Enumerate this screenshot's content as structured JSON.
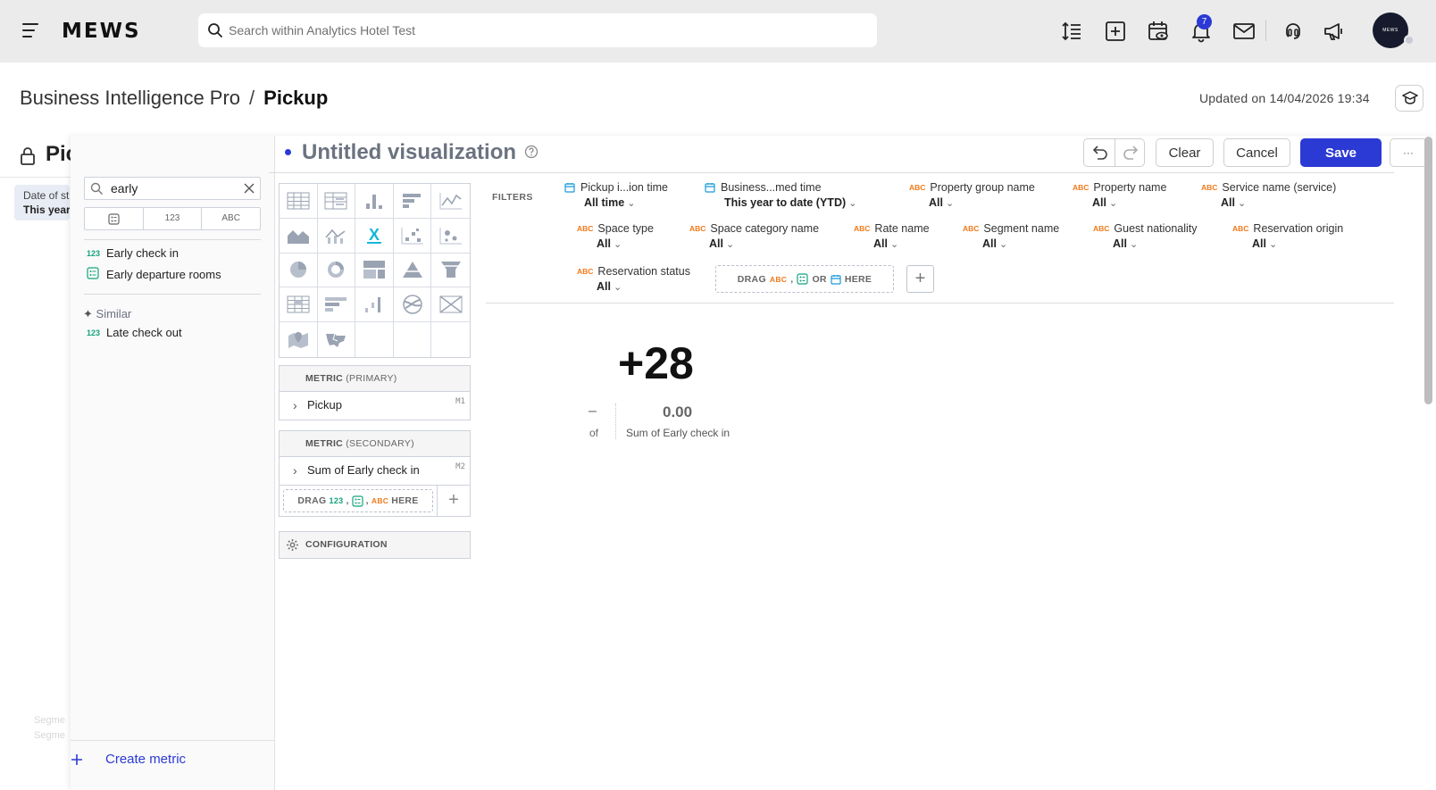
{
  "topbar": {
    "logo": "MEWS",
    "search_placeholder": "Search within Analytics Hotel Test",
    "notification_count": "7",
    "avatar_text": "MEWS"
  },
  "header": {
    "breadcrumb_parent": "Business Intelligence Pro",
    "breadcrumb_sep": "/",
    "breadcrumb_current": "Pickup",
    "updated": "Updated on 14/04/2026 19:34"
  },
  "background": {
    "title": "Pic",
    "filter_label": "Date of st",
    "filter_value": "This year",
    "seg1": "Segme",
    "seg2": "Segme"
  },
  "catalog": {
    "search_value": "early",
    "type_tabs": [
      "",
      "123",
      "ABC"
    ],
    "results": [
      {
        "tag": "123",
        "label": "Early check in"
      },
      {
        "tag": "",
        "label": "Early departure rooms"
      }
    ],
    "similar_label": "Similar",
    "similar": [
      {
        "tag": "123",
        "label": "Late check out"
      }
    ],
    "create_metric": "Create metric"
  },
  "viz": {
    "title": "Untitled visualization",
    "selected_type_glyph": "X"
  },
  "toolbar": {
    "clear": "Clear",
    "cancel": "Cancel",
    "save": "Save",
    "more": "···"
  },
  "buckets": {
    "primary_title": "METRIC",
    "primary_sub": "(PRIMARY)",
    "primary_item": "Pickup",
    "primary_tag": "M1",
    "secondary_title": "METRIC",
    "secondary_sub": "(SECONDARY)",
    "secondary_item": "Sum of Early check in",
    "secondary_tag": "M2",
    "drag_text": "DRAG",
    "drag_num": "123",
    "drag_abc": "ABC",
    "drag_here": "HERE",
    "configuration": "CONFIGURATION"
  },
  "filters": {
    "label": "FILTERS",
    "items": [
      {
        "type": "date",
        "name": "Pickup i...ion time",
        "value": "All time"
      },
      {
        "type": "date",
        "name": "Business...med time",
        "value": "This year to date (YTD)"
      },
      {
        "type": "ABC",
        "name": "Property group name",
        "value": "All"
      },
      {
        "type": "ABC",
        "name": "Property name",
        "value": "All"
      },
      {
        "type": "ABC",
        "name": "Service name (service)",
        "value": "All"
      },
      {
        "type": "ABC",
        "name": "Space type",
        "value": "All"
      },
      {
        "type": "ABC",
        "name": "Space category name",
        "value": "All"
      },
      {
        "type": "ABC",
        "name": "Rate name",
        "value": "All"
      },
      {
        "type": "ABC",
        "name": "Segment name",
        "value": "All"
      },
      {
        "type": "ABC",
        "name": "Guest nationality",
        "value": "All"
      },
      {
        "type": "ABC",
        "name": "Reservation origin",
        "value": "All"
      },
      {
        "type": "ABC",
        "name": "Reservation status",
        "value": "All"
      }
    ],
    "drop_drag": "DRAG",
    "drop_abc": "ABC",
    "drop_or": "OR",
    "drop_here": "HERE"
  },
  "headline": {
    "primary_value": "+28",
    "dash": "–",
    "of": "of",
    "secondary_value": "0.00",
    "secondary_label": "Sum of Early check in"
  },
  "colors": {
    "accent": "#2b3ad4",
    "attribute_tag": "#f07a1a",
    "fact_tag": "#13a37b",
    "date_tag": "#1a9ad6"
  }
}
